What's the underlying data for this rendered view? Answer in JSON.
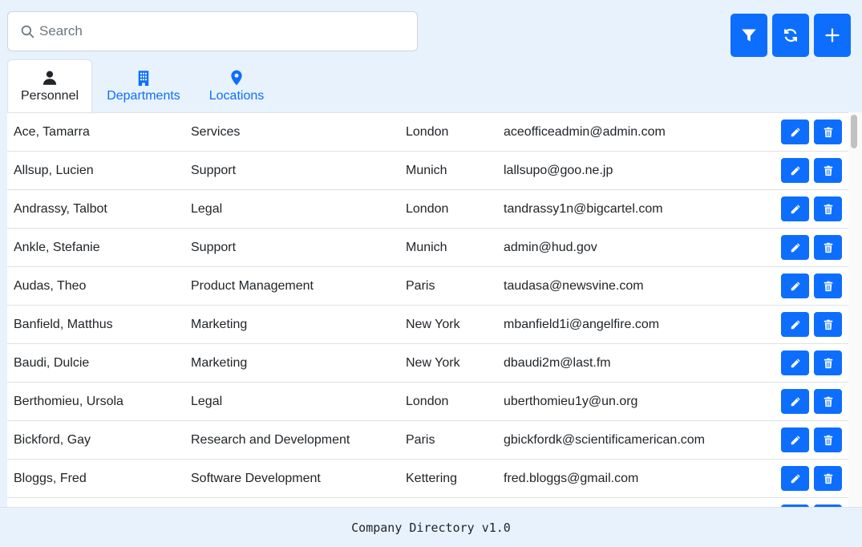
{
  "search": {
    "placeholder": "Search"
  },
  "toolbar": {
    "filter_icon": "filter-icon",
    "refresh_icon": "refresh-icon",
    "add_icon": "plus-icon"
  },
  "tabs": [
    {
      "label": "Personnel",
      "icon": "person-icon",
      "active": true
    },
    {
      "label": "Departments",
      "icon": "building-icon",
      "active": false
    },
    {
      "label": "Locations",
      "icon": "map-pin-icon",
      "active": false
    }
  ],
  "colors": {
    "primary": "#0d6efd",
    "background": "#e8f2fd"
  },
  "personnel": [
    {
      "name": "Ace, Tamarra",
      "department": "Services",
      "location": "London",
      "email": "aceofficeadmin@admin.com"
    },
    {
      "name": "Allsup, Lucien",
      "department": "Support",
      "location": "Munich",
      "email": "lallsupo@goo.ne.jp"
    },
    {
      "name": "Andrassy, Talbot",
      "department": "Legal",
      "location": "London",
      "email": "tandrassy1n@bigcartel.com"
    },
    {
      "name": "Ankle, Stefanie",
      "department": "Support",
      "location": "Munich",
      "email": "admin@hud.gov"
    },
    {
      "name": "Audas, Theo",
      "department": "Product Management",
      "location": "Paris",
      "email": "taudasa@newsvine.com"
    },
    {
      "name": "Banfield, Matthus",
      "department": "Marketing",
      "location": "New York",
      "email": "mbanfield1i@angelfire.com"
    },
    {
      "name": "Baudi, Dulcie",
      "department": "Marketing",
      "location": "New York",
      "email": "dbaudi2m@last.fm"
    },
    {
      "name": "Berthomieu, Ursola",
      "department": "Legal",
      "location": "London",
      "email": "uberthomieu1y@un.org"
    },
    {
      "name": "Bickford, Gay",
      "department": "Research and Development",
      "location": "Paris",
      "email": "gbickfordk@scientificamerican.com"
    },
    {
      "name": "Bloggs, Fred",
      "department": "Software Development",
      "location": "Kettering",
      "email": "fred.bloggs@gmail.com"
    },
    {
      "name": "",
      "department": "",
      "location": "",
      "email": ""
    }
  ],
  "footer": {
    "text": "Company Directory v1.0"
  }
}
